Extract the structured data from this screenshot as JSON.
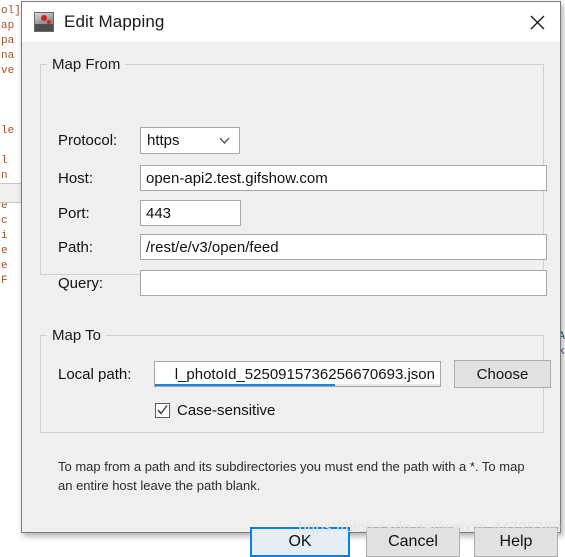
{
  "window": {
    "title": "Edit Mapping",
    "icon": "charles-proxy-icon",
    "close_icon": "close-icon"
  },
  "map_from": {
    "legend": "Map From",
    "fields": [
      {
        "label": "Protocol:",
        "value": "https",
        "type": "combobox",
        "icon": "chevron-down-icon"
      },
      {
        "label": "Host:",
        "value": "open-api2.test.gifshow.com",
        "type": "text"
      },
      {
        "label": "Port:",
        "value": "443",
        "type": "text"
      },
      {
        "label": "Path:",
        "value": "/rest/e/v3/open/feed",
        "type": "text"
      },
      {
        "label": "Query:",
        "value": "",
        "type": "text"
      }
    ]
  },
  "map_to": {
    "legend": "Map To",
    "local_path_label": "Local path:",
    "local_path_value": "l_photoId_5250915736256670693.json",
    "choose_label": "Choose",
    "case_sensitive_label": "Case-sensitive",
    "case_sensitive_checked": true,
    "check_icon": "checkmark-icon"
  },
  "help": {
    "text": "To map from a path and its subdirectories you must end the path with a *. To map an entire host leave the path blank."
  },
  "buttons": {
    "ok": "OK",
    "cancel": "Cancel",
    "help": "Help"
  },
  "watermark": {
    "text": "https://blog.csdn.net/weixin_44725380"
  },
  "background": {
    "left_code": "ol]\nap\npa\nna\nve\n\n\n\nle\n\nl\nn\ne\ne\nc\ni\ne\ne\nF",
    "right_code": "A\nk"
  },
  "colors": {
    "accent": "#0a7fdd",
    "dialog_bg": "#efefef",
    "field_border": "#a7a7a7",
    "scroll_thumb": "#2f7fd1"
  }
}
